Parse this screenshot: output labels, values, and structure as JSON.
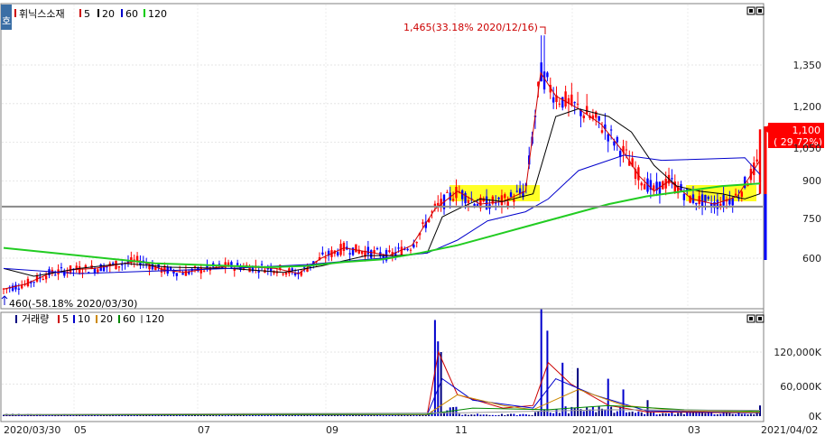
{
  "price_panel": {
    "corner_icon": "ho-badge",
    "corner_label": "호",
    "legend": [
      {
        "label": "휘닉스소재",
        "color": "#cc0000"
      },
      {
        "label": "5",
        "color": "#cc0000"
      },
      {
        "label": "20",
        "color": "#000000"
      },
      {
        "label": "60",
        "color": "#0000cc"
      },
      {
        "label": "120",
        "color": "#00cc00"
      }
    ],
    "panel_buttons": [
      "minimize-box-icon",
      "close-box-icon"
    ],
    "high_annotation": "1,465(33.18% 2020/12/16)",
    "low_annotation": "460(-58.18% 2020/03/30)",
    "current_price": "1,100",
    "current_change": "( 29.72%)",
    "price_axis_ticks": [
      "1,350",
      "1,200",
      "1,050",
      "900",
      "750",
      "600"
    ],
    "reference_line": 800
  },
  "volume_panel": {
    "legend": [
      {
        "label": "거래량",
        "color": "#000000"
      },
      {
        "label": "5",
        "color": "#cc0000"
      },
      {
        "label": "10",
        "color": "#0000cc"
      },
      {
        "label": "20",
        "color": "#cc8800"
      },
      {
        "label": "60",
        "color": "#008800"
      },
      {
        "label": "120",
        "color": "#999999"
      }
    ],
    "volume_axis_ticks": [
      "120,000K",
      "60,000K",
      "0K"
    ]
  },
  "x_axis": {
    "labels": [
      "2020/03/30",
      "05",
      "07",
      "09",
      "11",
      "2021/01",
      "03",
      "2021/04/02"
    ]
  },
  "chart_data": {
    "type": "candlestick",
    "title": "휘닉스소재",
    "x_range": [
      "2020/03/30",
      "2021/04/02"
    ],
    "price_ylim": [
      460,
      1465
    ],
    "high": {
      "value": 1465,
      "pct": 33.18,
      "date": "2020/12/16"
    },
    "low": {
      "value": 460,
      "pct": -58.18,
      "date": "2020/03/30"
    },
    "last_close": 1100,
    "last_change_pct": 29.72,
    "moving_averages": [
      5,
      20,
      60,
      120
    ],
    "series": [
      {
        "name": "5",
        "points": [
          [
            0,
            480
          ],
          [
            0.03,
            500
          ],
          [
            0.06,
            540
          ],
          [
            0.09,
            555
          ],
          [
            0.12,
            560
          ],
          [
            0.15,
            575
          ],
          [
            0.18,
            590
          ],
          [
            0.21,
            555
          ],
          [
            0.24,
            545
          ],
          [
            0.27,
            560
          ],
          [
            0.3,
            570
          ],
          [
            0.33,
            565
          ],
          [
            0.36,
            560
          ],
          [
            0.39,
            540
          ],
          [
            0.42,
            600
          ],
          [
            0.45,
            640
          ],
          [
            0.48,
            625
          ],
          [
            0.51,
            610
          ],
          [
            0.54,
            650
          ],
          [
            0.57,
            790
          ],
          [
            0.6,
            860
          ],
          [
            0.63,
            810
          ],
          [
            0.66,
            820
          ],
          [
            0.69,
            860
          ],
          [
            0.71,
            1320
          ],
          [
            0.73,
            1230
          ],
          [
            0.76,
            1180
          ],
          [
            0.79,
            1120
          ],
          [
            0.82,
            1010
          ],
          [
            0.84,
            920
          ],
          [
            0.86,
            860
          ],
          [
            0.88,
            900
          ],
          [
            0.91,
            830
          ],
          [
            0.94,
            810
          ],
          [
            0.97,
            840
          ],
          [
            1,
            980
          ]
        ]
      },
      {
        "name": "20",
        "points": [
          [
            0,
            560
          ],
          [
            0.04,
            530
          ],
          [
            0.1,
            560
          ],
          [
            0.16,
            580
          ],
          [
            0.22,
            565
          ],
          [
            0.3,
            560
          ],
          [
            0.37,
            545
          ],
          [
            0.42,
            570
          ],
          [
            0.48,
            610
          ],
          [
            0.52,
            610
          ],
          [
            0.56,
            620
          ],
          [
            0.58,
            760
          ],
          [
            0.6,
            790
          ],
          [
            0.63,
            830
          ],
          [
            0.66,
            820
          ],
          [
            0.7,
            850
          ],
          [
            0.73,
            1150
          ],
          [
            0.76,
            1180
          ],
          [
            0.8,
            1150
          ],
          [
            0.83,
            1090
          ],
          [
            0.86,
            960
          ],
          [
            0.89,
            880
          ],
          [
            0.92,
            860
          ],
          [
            0.95,
            850
          ],
          [
            0.98,
            830
          ],
          [
            1,
            850
          ]
        ]
      },
      {
        "name": "60",
        "points": [
          [
            0,
            560
          ],
          [
            0.1,
            540
          ],
          [
            0.2,
            550
          ],
          [
            0.3,
            560
          ],
          [
            0.4,
            575
          ],
          [
            0.5,
            600
          ],
          [
            0.56,
            620
          ],
          [
            0.6,
            670
          ],
          [
            0.64,
            745
          ],
          [
            0.69,
            780
          ],
          [
            0.72,
            830
          ],
          [
            0.76,
            940
          ],
          [
            0.82,
            1000
          ],
          [
            0.87,
            980
          ],
          [
            0.93,
            985
          ],
          [
            0.98,
            990
          ],
          [
            1,
            925
          ]
        ]
      },
      {
        "name": "120",
        "points": [
          [
            0,
            640
          ],
          [
            0.05,
            625
          ],
          [
            0.1,
            610
          ],
          [
            0.15,
            595
          ],
          [
            0.2,
            580
          ],
          [
            0.25,
            575
          ],
          [
            0.3,
            570
          ],
          [
            0.35,
            565
          ],
          [
            0.4,
            570
          ],
          [
            0.45,
            585
          ],
          [
            0.5,
            595
          ],
          [
            0.55,
            620
          ],
          [
            0.6,
            650
          ],
          [
            0.65,
            690
          ],
          [
            0.7,
            730
          ],
          [
            0.75,
            770
          ],
          [
            0.8,
            810
          ],
          [
            0.85,
            840
          ],
          [
            0.9,
            860
          ],
          [
            0.95,
            880
          ],
          [
            1,
            890
          ]
        ]
      }
    ],
    "volume_ylim": [
      0,
      180000
    ],
    "volume_unit": "K",
    "volume_spikes": [
      [
        0.57,
        180000
      ],
      [
        0.58,
        120000
      ],
      [
        0.575,
        140000
      ],
      [
        0.71,
        200000
      ],
      [
        0.72,
        160000
      ],
      [
        0.74,
        100000
      ],
      [
        0.76,
        90000
      ],
      [
        0.8,
        70000
      ],
      [
        0.82,
        50000
      ],
      [
        0.85,
        30000
      ],
      [
        1,
        20000
      ]
    ]
  }
}
